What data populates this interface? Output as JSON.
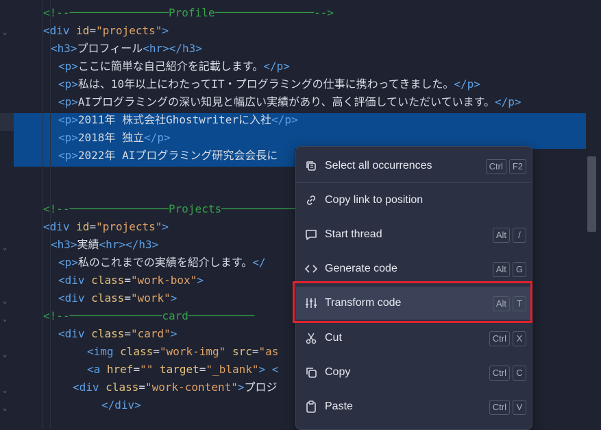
{
  "code": {
    "lines": [
      [
        [
          "cm",
          "<!--"
        ],
        [
          "cm",
          "───────────────Profile───────────────"
        ],
        [
          "cm",
          "-->"
        ]
      ],
      [
        [
          "tag",
          "<div"
        ],
        [
          "txt",
          " "
        ],
        [
          "attr",
          "id"
        ],
        [
          "txt",
          "="
        ],
        [
          "str",
          "\"projects\""
        ],
        [
          "tag",
          ">"
        ]
      ],
      [
        [
          "tag",
          "<h3>"
        ],
        [
          "txt",
          "プロフィール"
        ],
        [
          "tag",
          "<hr></h3>"
        ]
      ],
      [
        [
          "tag",
          "<p>"
        ],
        [
          "txt",
          "ここに簡単な自己紹介を記載します。"
        ],
        [
          "tag",
          "</p>"
        ]
      ],
      [
        [
          "tag",
          "<p>"
        ],
        [
          "txt",
          "私は、10年以上にわたってIT・プログラミングの仕事に携わってきました。"
        ],
        [
          "tag",
          "</p>"
        ]
      ],
      [
        [
          "tag",
          "<p>"
        ],
        [
          "txt",
          "AIプログラミングの深い知見と幅広い実績があり、高く評価していただいています。"
        ],
        [
          "tag",
          "</p>"
        ]
      ],
      [
        [
          "tag",
          "<p>"
        ],
        [
          "txt",
          "2011年 株式会社Ghostwriterに入社"
        ],
        [
          "tag",
          "</p>"
        ]
      ],
      [
        [
          "tag",
          "<p>"
        ],
        [
          "txt",
          "2018年 独立"
        ],
        [
          "tag",
          "</p>"
        ]
      ],
      [
        [
          "tag",
          "<p>"
        ],
        [
          "txt",
          "2022年 AIプログラミング研究会会長に"
        ]
      ],
      [],
      [],
      [
        [
          "cm",
          "<!--"
        ],
        [
          "cm",
          "───────────────Projects────────────"
        ]
      ],
      [
        [
          "tag",
          "<div"
        ],
        [
          "txt",
          " "
        ],
        [
          "attr",
          "id"
        ],
        [
          "txt",
          "="
        ],
        [
          "str",
          "\"projects\""
        ],
        [
          "tag",
          ">"
        ]
      ],
      [
        [
          "tag",
          "<h3>"
        ],
        [
          "txt",
          "実績"
        ],
        [
          "tag",
          "<hr></h3>"
        ]
      ],
      [
        [
          "tag",
          "<p>"
        ],
        [
          "txt",
          "私のこれまでの実績を紹介します。"
        ],
        [
          "tag",
          "</"
        ]
      ],
      [
        [
          "tag",
          "<div"
        ],
        [
          "txt",
          " "
        ],
        [
          "attr",
          "class"
        ],
        [
          "txt",
          "="
        ],
        [
          "str",
          "\"work-box\""
        ],
        [
          "tag",
          ">"
        ]
      ],
      [
        [
          "tag",
          "<div"
        ],
        [
          "txt",
          " "
        ],
        [
          "attr",
          "class"
        ],
        [
          "txt",
          "="
        ],
        [
          "str",
          "\"work\""
        ],
        [
          "tag",
          ">"
        ]
      ],
      [
        [
          "cm",
          "<!--"
        ],
        [
          "cm",
          "──────────────card──────────"
        ]
      ],
      [
        [
          "tag",
          "<div"
        ],
        [
          "txt",
          " "
        ],
        [
          "attr",
          "class"
        ],
        [
          "txt",
          "="
        ],
        [
          "str",
          "\"card\""
        ],
        [
          "tag",
          ">"
        ]
      ],
      [
        [
          "tag",
          "<img"
        ],
        [
          "txt",
          " "
        ],
        [
          "attr",
          "class"
        ],
        [
          "txt",
          "="
        ],
        [
          "str",
          "\"work-img\""
        ],
        [
          "txt",
          " "
        ],
        [
          "attr",
          "src"
        ],
        [
          "txt",
          "="
        ],
        [
          "str",
          "\"as"
        ]
      ],
      [
        [
          "tag",
          "<a"
        ],
        [
          "txt",
          " "
        ],
        [
          "attr",
          "href"
        ],
        [
          "txt",
          "="
        ],
        [
          "str",
          "\"\""
        ],
        [
          "txt",
          " "
        ],
        [
          "attr",
          "target"
        ],
        [
          "txt",
          "="
        ],
        [
          "str",
          "\"_blank\""
        ],
        [
          "tag",
          "> <"
        ]
      ],
      [
        [
          "tag",
          "<div"
        ],
        [
          "txt",
          " "
        ],
        [
          "attr",
          "class"
        ],
        [
          "txt",
          "="
        ],
        [
          "str",
          "\"work-content\""
        ],
        [
          "tag",
          ">"
        ],
        [
          "txt",
          "プロジ"
        ]
      ],
      [
        [
          "tag",
          "</div>"
        ]
      ]
    ]
  },
  "menu": {
    "items": [
      {
        "label": "Select all occurrences",
        "icon": "copy-stack-icon",
        "keys": [
          "Ctrl",
          "F2"
        ]
      },
      {
        "label": "Copy link to position",
        "icon": "link-icon",
        "keys": []
      },
      {
        "label": "Start thread",
        "icon": "comment-icon",
        "keys": [
          "Alt",
          "/"
        ]
      },
      {
        "label": "Generate code",
        "icon": "code-brackets-icon",
        "keys": [
          "Alt",
          "G"
        ]
      },
      {
        "label": "Transform code",
        "icon": "sliders-icon",
        "keys": [
          "Alt",
          "T"
        ]
      },
      {
        "label": "Cut",
        "icon": "scissors-icon",
        "keys": [
          "Ctrl",
          "X"
        ]
      },
      {
        "label": "Copy",
        "icon": "copy-icon",
        "keys": [
          "Ctrl",
          "C"
        ]
      },
      {
        "label": "Paste",
        "icon": "clipboard-icon",
        "keys": [
          "Ctrl",
          "V"
        ]
      }
    ]
  },
  "colors": {
    "highlight_box": "#e0222e",
    "selection": "#0b4a8e",
    "menu_bg": "#2b3142"
  }
}
